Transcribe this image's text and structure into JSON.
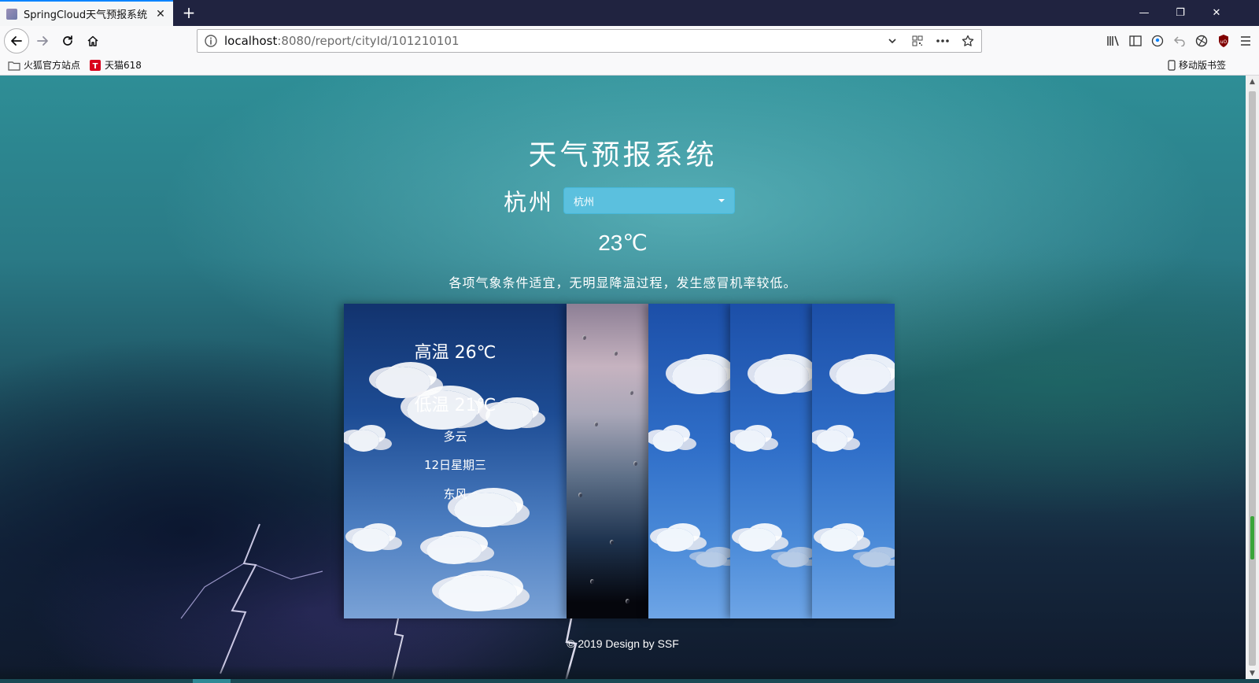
{
  "browser": {
    "tab_title": "SpringCloud天气预报系统",
    "tab_close": "✕",
    "new_tab": "+",
    "window_controls": {
      "minimize": "—",
      "restore": "❐",
      "close": "✕"
    },
    "url_host": "localhost",
    "url_rest": ":8080/report/cityId/101210101",
    "bookmarks": [
      {
        "label": "火狐官方站点",
        "icon": "folder-icon"
      },
      {
        "label": "天猫618",
        "icon": "tmall-icon"
      }
    ],
    "mobile_bookmarks": "移动版书签"
  },
  "page": {
    "title": "天气预报系统",
    "city_name": "杭州",
    "city_select": {
      "selected": "杭州",
      "color": "#5bc0de"
    },
    "current_temp": "23℃",
    "advice": "各项气象条件适宜，无明显降温过程，发生感冒机率较低。",
    "forecast": {
      "high": "高温 26℃",
      "low": "低温 21℃",
      "condition": "多云",
      "date": "12日星期三",
      "wind": "东风"
    },
    "footer": "© 2019 Design by SSF"
  }
}
